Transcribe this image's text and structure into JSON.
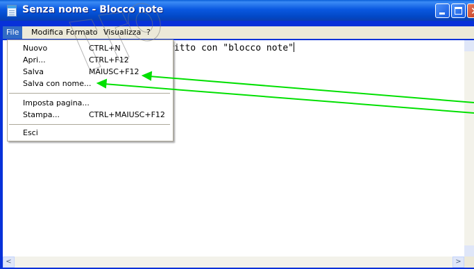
{
  "window": {
    "title": "Senza nome - Blocco note"
  },
  "menubar": {
    "items": [
      "File",
      "Modifica",
      "Formato",
      "Visualizza",
      "?"
    ]
  },
  "editor": {
    "text": "ritto con \"blocco note\""
  },
  "file_menu": {
    "items": [
      {
        "label": "Nuovo",
        "shortcut": "CTRL+N"
      },
      {
        "label": "Apri...",
        "shortcut": "CTRL+F12"
      },
      {
        "label": "Salva",
        "shortcut": "MAIUSC+F12"
      },
      {
        "label": "Salva con nome...",
        "shortcut": ""
      },
      {
        "label": "Imposta pagina...",
        "shortcut": ""
      },
      {
        "label": "Stampa...",
        "shortcut": "CTRL+MAIUSC+F12"
      },
      {
        "label": "Esci",
        "shortcut": ""
      }
    ]
  },
  "colors": {
    "titlebar": "#0a58e0",
    "menu_highlight": "#316ac5",
    "annotation_arrow": "#00e000"
  }
}
